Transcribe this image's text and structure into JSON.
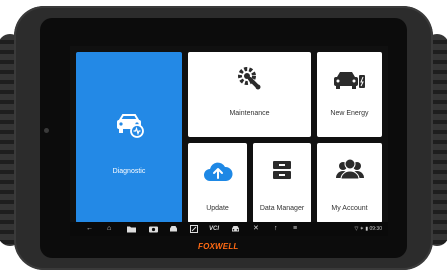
{
  "tiles": {
    "diagnostic": "Diagnostic",
    "maintenance": "Maintenance",
    "new_energy": "New Energy",
    "update": "Update",
    "data_manager": "Data Manager",
    "my_account": "My Account"
  },
  "status": {
    "time": "09:30"
  },
  "brand": {
    "name": "FOXWELL"
  },
  "colors": {
    "diagnostic_tile": "#2389e6",
    "icon": "#2b2b2b",
    "update_icon": "#1e88e5",
    "brand": "#ff6a13"
  },
  "navbar": {
    "icons": [
      "back-icon",
      "home-icon",
      "folder-icon",
      "camera-icon",
      "car-scan-icon",
      "screenshot-icon",
      "vci-icon",
      "car-icon",
      "tools-icon",
      "upload-icon",
      "menu-icon"
    ],
    "vci_label": "VCI"
  }
}
